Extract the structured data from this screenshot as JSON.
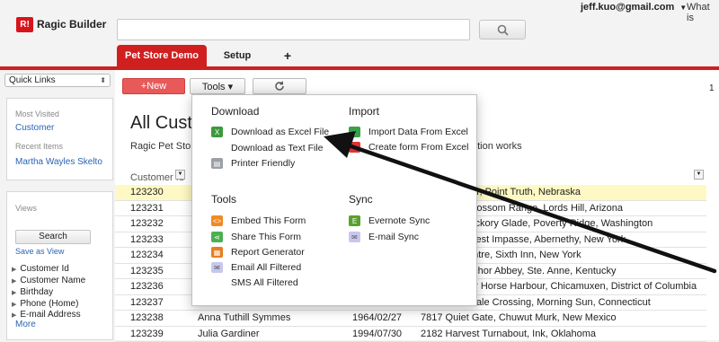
{
  "header": {
    "logo_mark": "R!",
    "logo_text": "Ragic Builder",
    "user": "jeff.kuo@gmail.com",
    "whatis": "What is",
    "tabs": [
      "Pet Store Demo",
      "Setup",
      "+"
    ]
  },
  "sidebar": {
    "quick_links": "Quick Links",
    "most_visited_label": "Most Visited",
    "most_visited_link": "Customer",
    "recent_items_label": "Recent Items",
    "recent_item": "Martha Wayles Skelto",
    "views_label": "Views",
    "search_button": "Search",
    "save_as_view": "Save as View",
    "fields": [
      "Customer Id",
      "Customer Name",
      "Birthday",
      "Phone (Home)",
      "E-mail Address"
    ],
    "more": "More"
  },
  "toolbar": {
    "new": "+New",
    "tools": "Tools ▾",
    "page_count": "1"
  },
  "main": {
    "title": "All Custo",
    "description_left": "Ragic Pet Store",
    "description_right": "ation works",
    "column_header": "Customer Id"
  },
  "rows": [
    {
      "id": "123230",
      "name": "",
      "date": "",
      "address": "Moor, Point Truth, Nebraska",
      "highlight": true
    },
    {
      "id": "123231",
      "name": "",
      "date": "",
      "address": "al Blossom Range, Lords Hill, Arizona"
    },
    {
      "id": "123232",
      "name": "",
      "date": "",
      "address": "e Hickory Glade, Poverty Ridge, Washington"
    },
    {
      "id": "123233",
      "name": "",
      "date": "",
      "address": "Forest Impasse, Abernethy, New York"
    },
    {
      "id": "123234",
      "name": "",
      "date": "",
      "address": "entre, Sixth Inn, New York"
    },
    {
      "id": "123235",
      "name": "",
      "date": "",
      "address": "nchor Abbey, Ste. Anne, Kentucky"
    },
    {
      "id": "123236",
      "name": "",
      "date": "",
      "address": "er Horse Harbour, Chicamuxen, District of Columbia"
    },
    {
      "id": "123237",
      "name": "",
      "date": "",
      "address": "Dale Crossing, Morning Sun, Connecticut"
    },
    {
      "id": "123238",
      "name": "Anna Tuthill Symmes",
      "date": "1964/02/27",
      "address": "7817 Quiet Gate, Chuwut Murk, New Mexico"
    },
    {
      "id": "123239",
      "name": "Julia Gardiner",
      "date": "1994/07/30",
      "address": "2182 Harvest Turnabout, Ink, Oklahoma"
    }
  ],
  "menu": {
    "download_header": "Download",
    "download_items": [
      "Download as Excel File",
      "Download as Text File",
      "Printer Friendly"
    ],
    "import_header": "Import",
    "import_items": [
      "Import Data From Excel",
      "Create form From Excel"
    ],
    "tools_header": "Tools",
    "tools_items": [
      "Embed This Form",
      "Share This Form",
      "Report Generator",
      "Email All Filtered",
      "SMS All Filtered"
    ],
    "sync_header": "Sync",
    "sync_items": [
      "Evernote Sync",
      "E-mail Sync"
    ]
  },
  "colors": {
    "brand_red": "#cf1f1f",
    "link_blue": "#2a64b3",
    "highlight_row": "#fef9c4"
  }
}
